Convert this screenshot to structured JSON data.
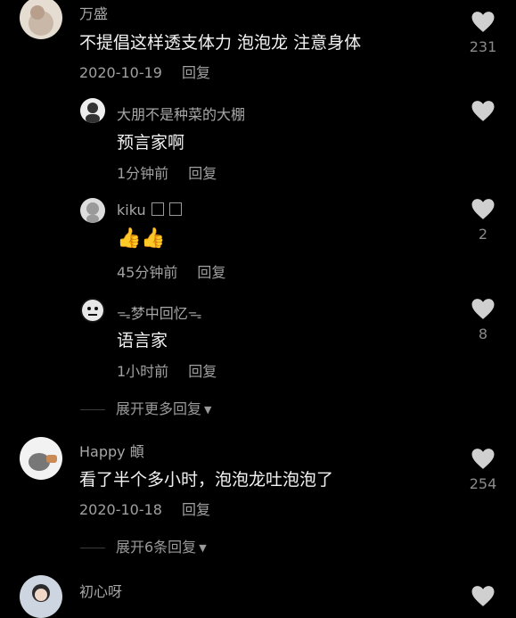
{
  "comments": [
    {
      "user": "万盛",
      "text": "不提倡这样透支体力 泡泡龙 注意身体",
      "date": "2020-10-19",
      "reply_label": "回复",
      "likes": "231"
    },
    {
      "user": "Happy 頔",
      "text": "看了半个多小时，泡泡龙吐泡泡了",
      "date": "2020-10-18",
      "reply_label": "回复",
      "likes": "254",
      "expand_label": "展开6条回复"
    },
    {
      "user": "初心呀"
    }
  ],
  "replies": [
    {
      "user": "大朋不是种菜的大棚",
      "text": "预言家啊",
      "time": "1分钟前",
      "reply_label": "回复"
    },
    {
      "user": "kiku",
      "text": "👍👍",
      "time": "45分钟前",
      "reply_label": "回复",
      "likes": "2"
    },
    {
      "user": "梦中回忆",
      "text": "语言家",
      "time": "1小时前",
      "reply_label": "回复",
      "likes": "8"
    }
  ],
  "expand_more_label": "展开更多回复",
  "colors": {
    "background": "#000000",
    "text": "#f2f2f2",
    "muted": "#a0a0a0"
  },
  "icons": [
    "heart-icon",
    "expand-triangle-icon",
    "avatar"
  ]
}
